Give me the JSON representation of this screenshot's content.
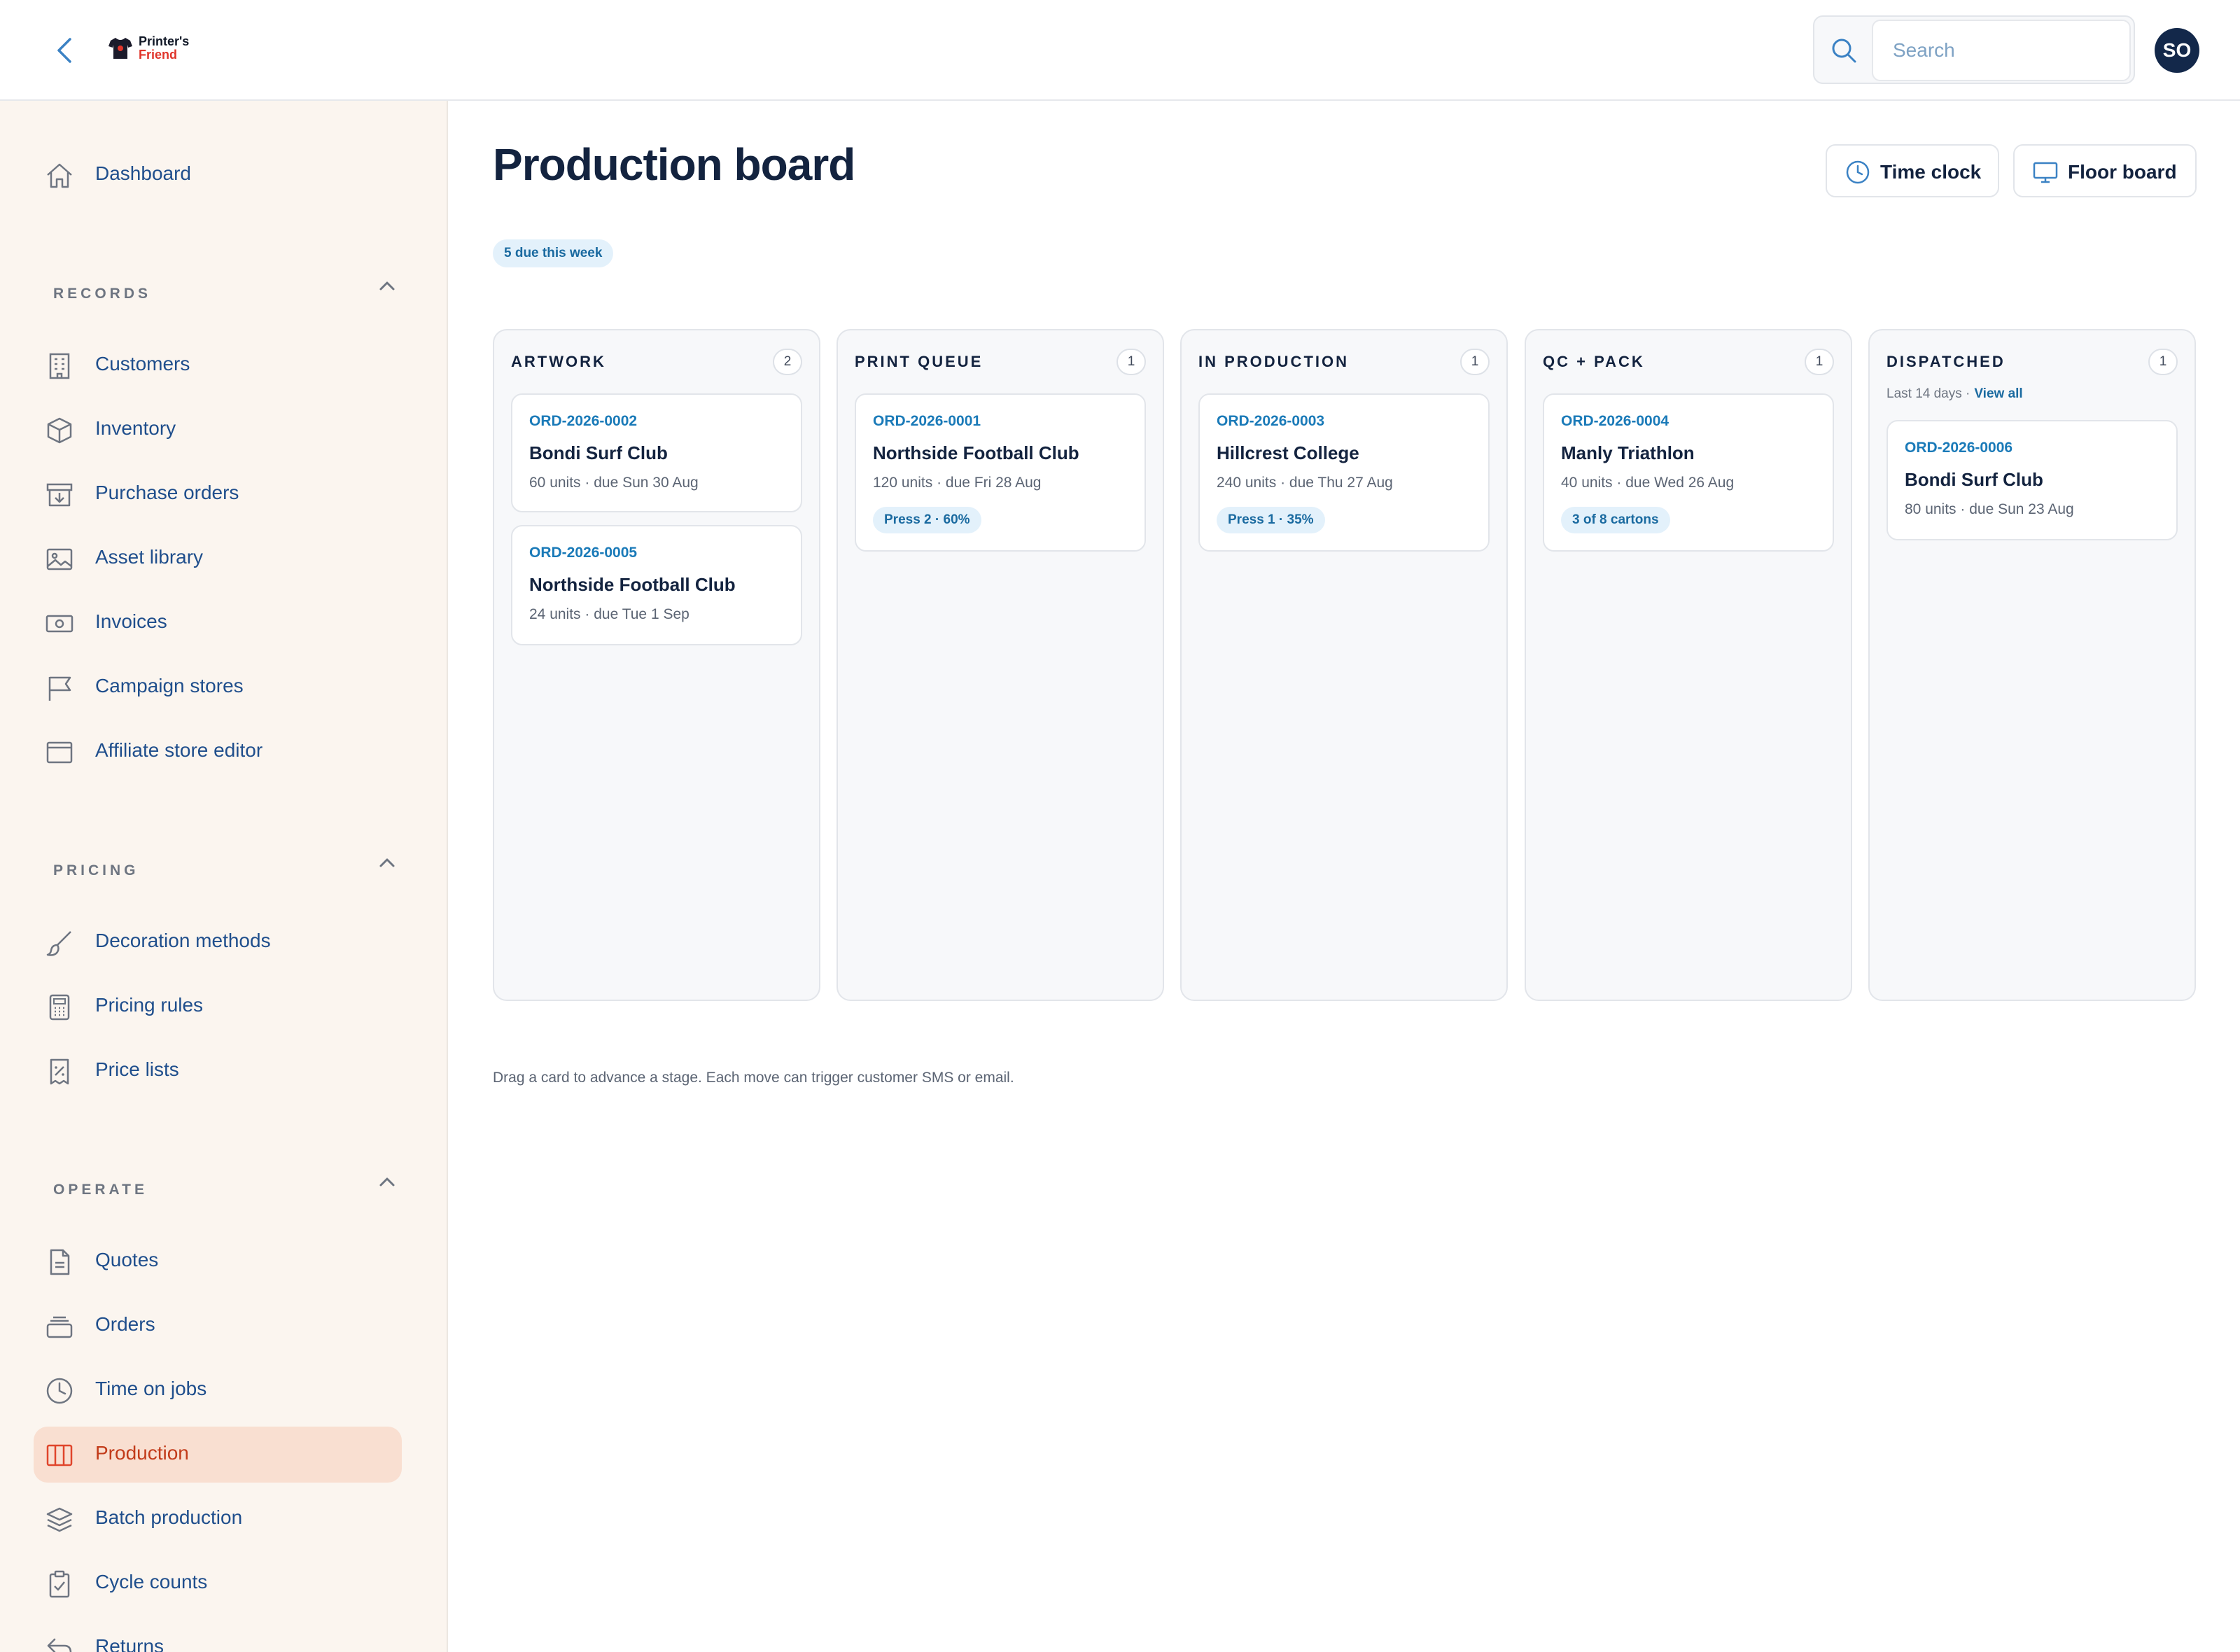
{
  "header": {
    "logo_line1": "Printer's",
    "logo_line2": "Friend",
    "search_placeholder": "Search",
    "avatar_initials": "SO"
  },
  "sidebar": {
    "dashboard": {
      "label": "Dashboard",
      "icon": "home-icon"
    },
    "sections": {
      "records": {
        "title": "RECORDS",
        "items": [
          {
            "label": "Customers",
            "icon": "building-icon"
          },
          {
            "label": "Inventory",
            "icon": "box-icon"
          },
          {
            "label": "Purchase orders",
            "icon": "archive-download-icon"
          },
          {
            "label": "Asset library",
            "icon": "image-icon"
          },
          {
            "label": "Invoices",
            "icon": "banknote-icon"
          },
          {
            "label": "Campaign stores",
            "icon": "flag-icon"
          },
          {
            "label": "Affiliate store editor",
            "icon": "browser-window-icon"
          }
        ]
      },
      "pricing": {
        "title": "PRICING",
        "items": [
          {
            "label": "Decoration methods",
            "icon": "brush-icon"
          },
          {
            "label": "Pricing rules",
            "icon": "calculator-icon"
          },
          {
            "label": "Price lists",
            "icon": "receipt-percent-icon"
          }
        ]
      },
      "operate": {
        "title": "OPERATE",
        "items": [
          {
            "label": "Quotes",
            "icon": "document-icon"
          },
          {
            "label": "Orders",
            "icon": "stack-tray-icon"
          },
          {
            "label": "Time on jobs",
            "icon": "clock-icon"
          },
          {
            "label": "Production",
            "icon": "columns-icon",
            "active": true
          },
          {
            "label": "Batch production",
            "icon": "layers-icon"
          },
          {
            "label": "Cycle counts",
            "icon": "clipboard-check-icon"
          },
          {
            "label": "Returns",
            "icon": "return-arrow-icon"
          }
        ]
      }
    }
  },
  "main": {
    "title": "Production board",
    "time_clock_label": "Time clock",
    "floor_board_label": "Floor board",
    "due_pill": "5 due this week",
    "footnote": "Drag a card to advance a stage. Each move can trigger customer SMS or email."
  },
  "board": {
    "columns": [
      {
        "title": "ARTWORK",
        "count": "2",
        "cards": [
          {
            "order_id": "ORD-2026-0002",
            "customer": "Bondi Surf Club",
            "meta": "60 units · due Sun 30 Aug"
          },
          {
            "order_id": "ORD-2026-0005",
            "customer": "Northside Football Club",
            "meta": "24 units · due Tue 1 Sep"
          }
        ]
      },
      {
        "title": "PRINT QUEUE",
        "count": "1",
        "cards": [
          {
            "order_id": "ORD-2026-0001",
            "customer": "Northside Football Club",
            "meta": "120 units · due Fri 28 Aug",
            "tag": "Press 2 · 60%"
          }
        ]
      },
      {
        "title": "IN PRODUCTION",
        "count": "1",
        "cards": [
          {
            "order_id": "ORD-2026-0003",
            "customer": "Hillcrest College",
            "meta": "240 units · due Thu 27 Aug",
            "tag": "Press 1 · 35%"
          }
        ]
      },
      {
        "title": "QC + PACK",
        "count": "1",
        "cards": [
          {
            "order_id": "ORD-2026-0004",
            "customer": "Manly Triathlon",
            "meta": "40 units · due Wed 26 Aug",
            "tag": "3 of 8 cartons"
          }
        ]
      },
      {
        "title": "DISPATCHED",
        "count": "1",
        "subtitle": "Last 14 days ·",
        "subtitle_link": "View all",
        "cards": [
          {
            "order_id": "ORD-2026-0006",
            "customer": "Bondi Surf Club",
            "meta": "80 units · due Sun 23 Aug"
          }
        ]
      }
    ]
  },
  "colors": {
    "accent_blue": "#1a7ab8",
    "nav_text": "#1f4e8c",
    "active_bg": "#f9dfd1",
    "active_text": "#c23b1a",
    "sidebar_bg": "#fbf5ef"
  }
}
